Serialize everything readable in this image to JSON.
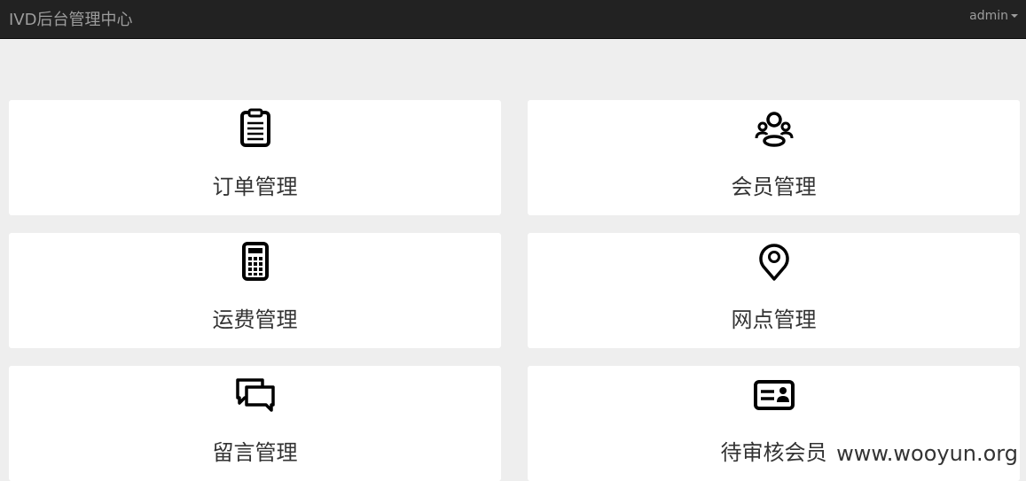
{
  "header": {
    "brand": "IVD后台管理中心",
    "user": "admin"
  },
  "tiles": [
    {
      "label": "订单管理",
      "icon": "clipboard-icon"
    },
    {
      "label": "会员管理",
      "icon": "users-icon"
    },
    {
      "label": "运费管理",
      "icon": "calculator-icon"
    },
    {
      "label": "网点管理",
      "icon": "map-pin-icon"
    },
    {
      "label": "留言管理",
      "icon": "chat-bubbles-icon"
    },
    {
      "label": "待审核会员",
      "icon": "id-card-icon"
    }
  ],
  "watermark": "www.wooyun.org"
}
